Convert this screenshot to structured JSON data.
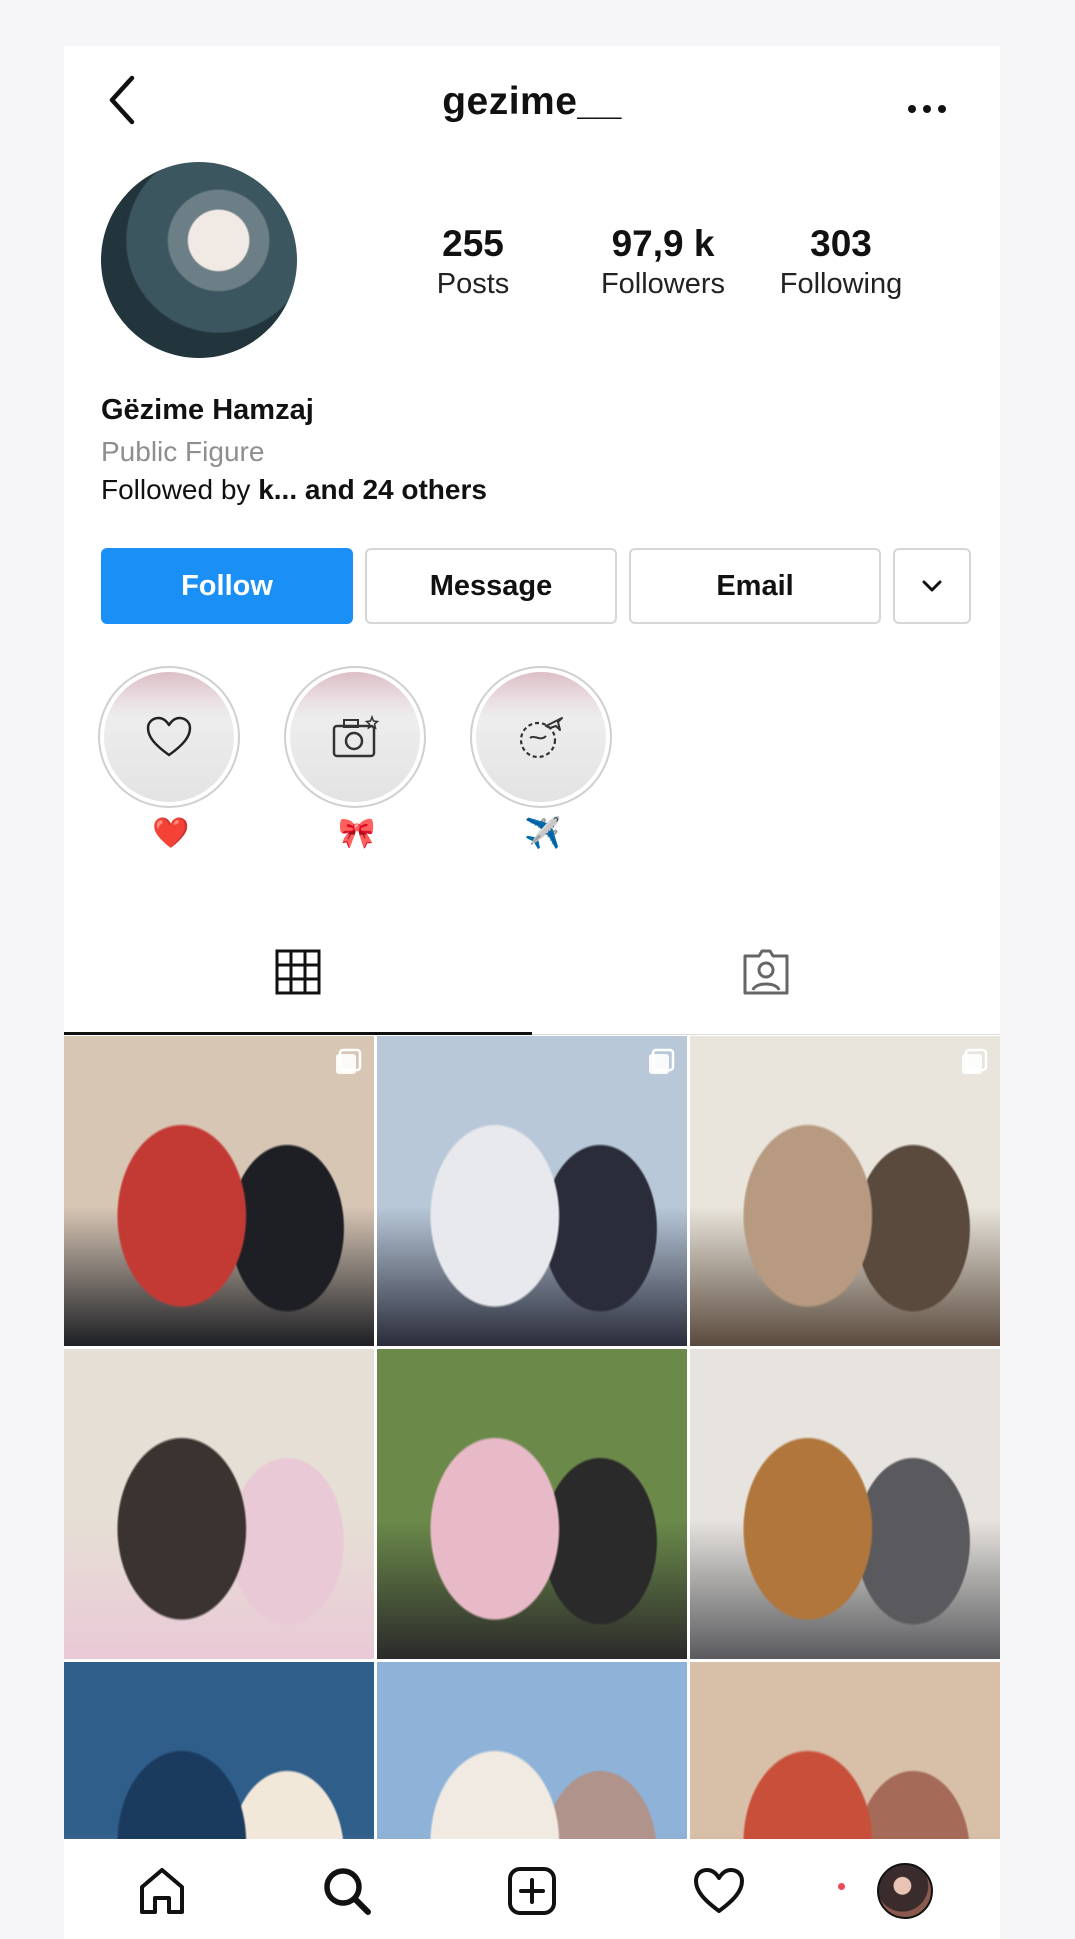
{
  "header": {
    "username": "gezime__"
  },
  "profile": {
    "stats": [
      {
        "value": "255",
        "label": "Posts"
      },
      {
        "value": "97,9 k",
        "label": "Followers"
      },
      {
        "value": "303",
        "label": "Following"
      }
    ],
    "full_name": "Gëzime Hamzaj",
    "category": "Public Figure",
    "followed_by_prefix": "Followed by ",
    "followed_by_names": "k...",
    "followed_by_suffix": " and 24 others"
  },
  "actions": {
    "follow_label": "Follow",
    "message_label": "Message",
    "email_label": "Email"
  },
  "highlights": [
    {
      "icon": "heart-icon",
      "label": "❤️"
    },
    {
      "icon": "camera-icon",
      "label": "🎀"
    },
    {
      "icon": "globe-plane-icon",
      "label": "✈️"
    }
  ],
  "tabs": [
    {
      "icon": "grid-icon",
      "active": true
    },
    {
      "icon": "tagged-icon",
      "active": false
    }
  ],
  "posts": [
    {
      "palette": [
        "#d8c6b5",
        "#c33a34",
        "#1d1f24"
      ],
      "multi": true
    },
    {
      "palette": [
        "#b8c8d8",
        "#e7e9ec",
        "#2a2c3a"
      ],
      "multi": true
    },
    {
      "palette": [
        "#e9e5dc",
        "#b79a80",
        "#5a4a3d"
      ],
      "multi": true
    },
    {
      "palette": [
        "#e6dfd5",
        "#3a332f",
        "#e9c9d6"
      ],
      "multi": false
    },
    {
      "palette": [
        "#6b8a4a",
        "#e8b9c6",
        "#2b2a2a"
      ],
      "multi": false
    },
    {
      "palette": [
        "#e7e4df",
        "#b0763c",
        "#5a5a5e"
      ],
      "multi": false
    },
    {
      "palette": [
        "#2f5e8a",
        "#1a3a5e",
        "#f1e8d9"
      ],
      "multi": false
    },
    {
      "palette": [
        "#8fb2d8",
        "#f0eae3",
        "#b0938a"
      ],
      "multi": false
    },
    {
      "palette": [
        "#d8bfa8",
        "#c8503a",
        "#a66a58"
      ],
      "multi": false
    }
  ],
  "colors": {
    "accent": "#1a8ff5",
    "notification_dot": "#ed4956"
  }
}
